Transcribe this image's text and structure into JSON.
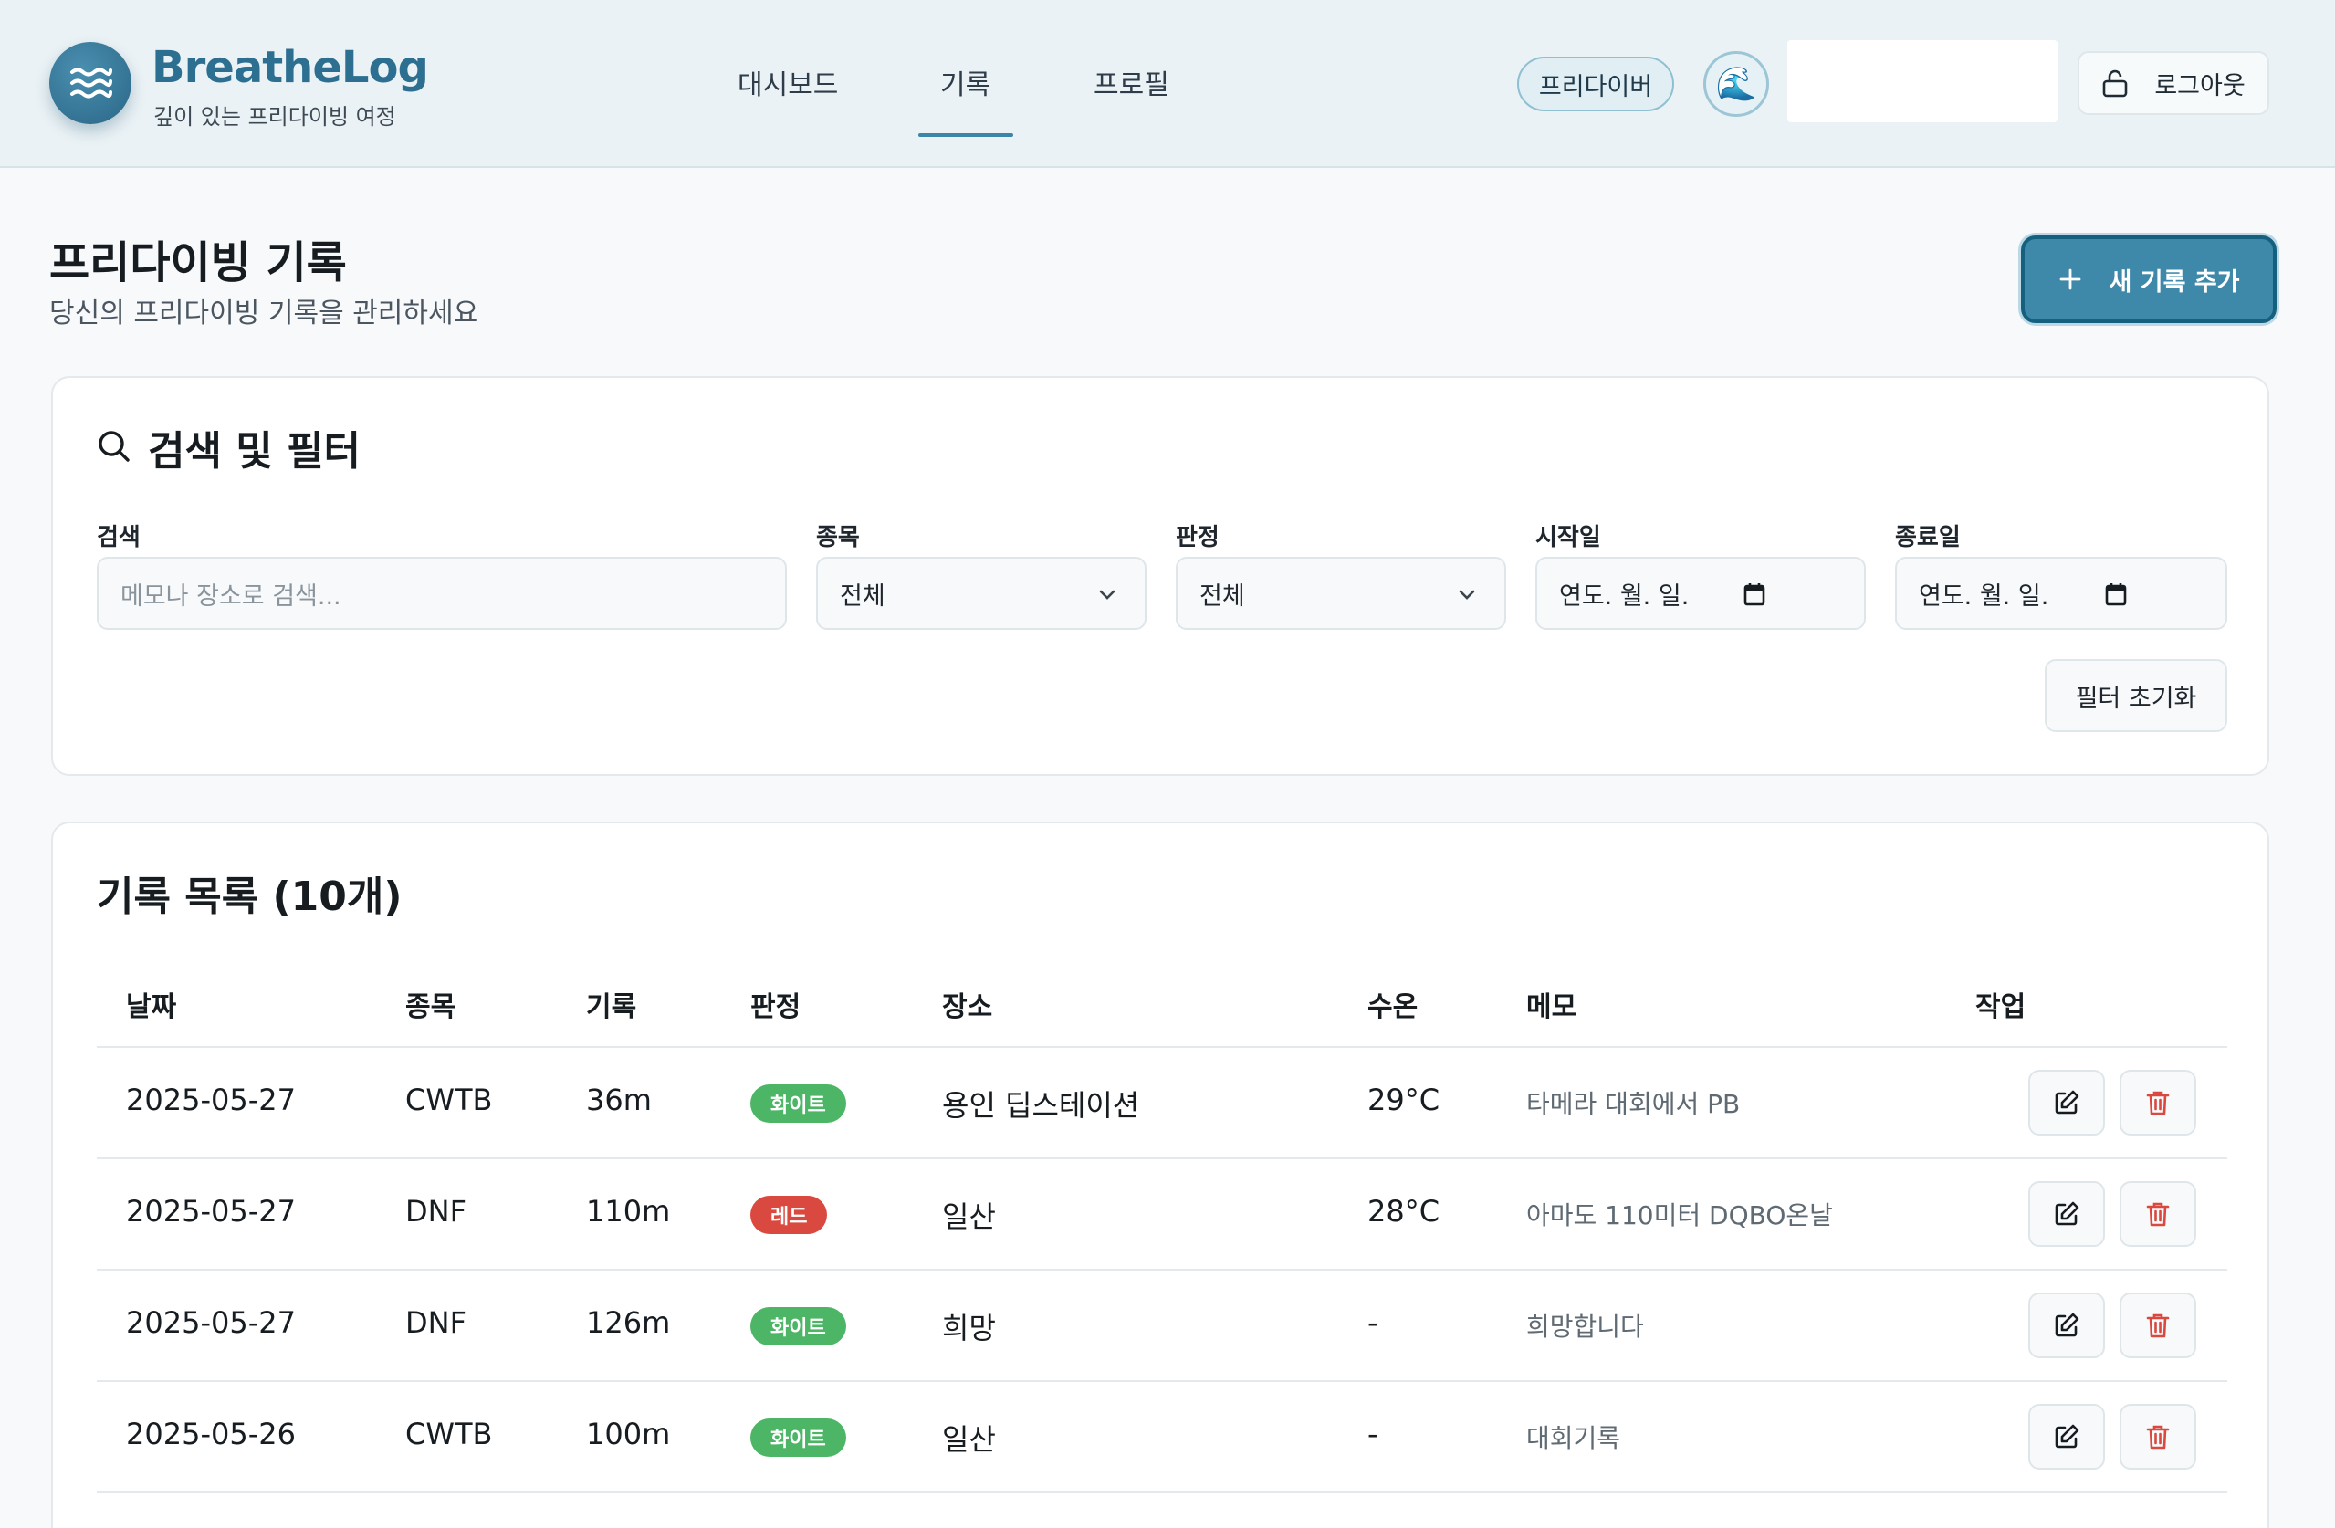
{
  "brand": {
    "name": "BreatheLog",
    "tagline": "깊이 있는 프리다이빙 여정"
  },
  "nav": [
    {
      "label": "대시보드",
      "active": false
    },
    {
      "label": "기록",
      "active": true
    },
    {
      "label": "프로필",
      "active": false
    }
  ],
  "user": {
    "role_badge": "프리다이버",
    "avatar_glyph": "🌊",
    "logout_label": "로그아웃"
  },
  "page": {
    "title": "프리다이빙 기록",
    "subtitle": "당신의 프리다이빙 기록을 관리하세요",
    "add_label": "새 기록 추가"
  },
  "filters": {
    "title": "검색 및 필터",
    "search_label": "검색",
    "search_placeholder": "메모나 장소로 검색...",
    "discipline_label": "종목",
    "discipline_value": "전체",
    "verdict_label": "판정",
    "verdict_value": "전체",
    "start_label": "시작일",
    "start_value": "연도. 월. 일.",
    "end_label": "종료일",
    "end_value": "연도. 월. 일.",
    "reset_label": "필터 초기화"
  },
  "records": {
    "title": "기록 목록 (10개)",
    "columns": [
      "날짜",
      "종목",
      "기록",
      "판정",
      "장소",
      "수온",
      "메모",
      "작업"
    ],
    "rows": [
      {
        "date": "2025-05-27",
        "discipline": "CWTB",
        "record": "36m",
        "verdict": "화이트",
        "verdict_color": "#4cb566",
        "place": "용인 딥스테이션",
        "temp": "29°C",
        "memo": "타메라 대회에서 PB"
      },
      {
        "date": "2025-05-27",
        "discipline": "DNF",
        "record": "110m",
        "verdict": "레드",
        "verdict_color": "#d9493f",
        "place": "일산",
        "temp": "28°C",
        "memo": "아마도 110미터 DQBO온날"
      },
      {
        "date": "2025-05-27",
        "discipline": "DNF",
        "record": "126m",
        "verdict": "화이트",
        "verdict_color": "#4cb566",
        "place": "희망",
        "temp": "-",
        "memo": "희망합니다"
      },
      {
        "date": "2025-05-26",
        "discipline": "CWTB",
        "record": "100m",
        "verdict": "화이트",
        "verdict_color": "#4cb566",
        "place": "일산",
        "temp": "-",
        "memo": "대회기록"
      }
    ]
  },
  "colors": {
    "accent": "#3e88a9",
    "brand": "#2d6f91",
    "danger": "#d9493f",
    "success": "#4cb566"
  },
  "icons": {
    "logo": "waves-icon",
    "logout": "unlock-icon",
    "add": "plus-icon",
    "search": "search-icon",
    "select": "chevron-down-icon",
    "date": "calendar-icon",
    "edit": "edit-icon",
    "delete": "trash-icon"
  }
}
